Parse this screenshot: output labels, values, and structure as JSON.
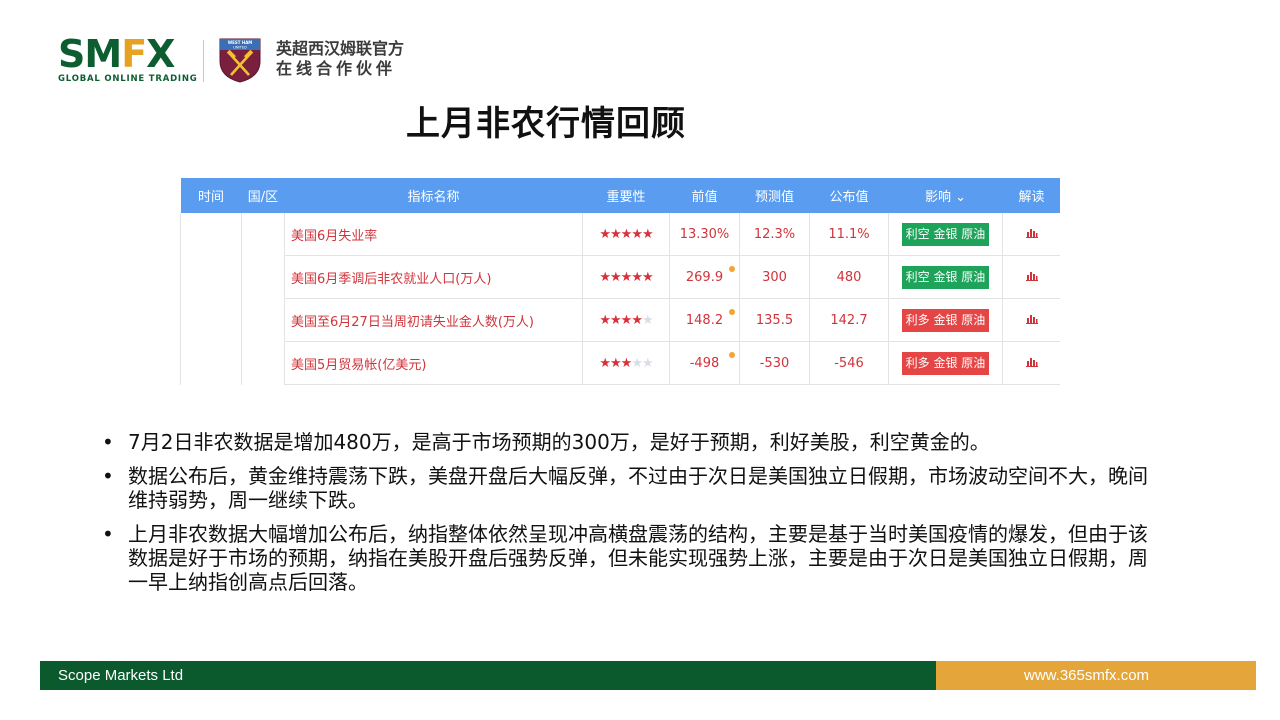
{
  "header": {
    "brand_main": "SMFX",
    "brand_sub": "GLOBAL ONLINE TRADING",
    "crest_text": "WEST HAM UNITED",
    "partner_line1": "英超西汉姆联官方",
    "partner_line2": "在线合作伙伴"
  },
  "title": "上月非农行情回顾",
  "table": {
    "headers": [
      "时间",
      "国/区",
      "指标名称",
      "重要性",
      "前值",
      "预测值",
      "公布值",
      "影响 ⌄",
      "解读"
    ],
    "rows": [
      {
        "name": "美国6月失业率",
        "stars": 5,
        "prev": "13.30%",
        "forecast": "12.3%",
        "actual": "11.1%",
        "impact": "利空 金银 原油",
        "impact_color": "#1da35a",
        "dot": false
      },
      {
        "name": "美国6月季调后非农就业人口(万人)",
        "stars": 5,
        "prev": "269.9",
        "forecast": "300",
        "actual": "480",
        "impact": "利空 金银 原油",
        "impact_color": "#1da35a",
        "dot": true
      },
      {
        "name": "美国至6月27日当周初请失业金人数(万人)",
        "stars": 4,
        "prev": "148.2",
        "forecast": "135.5",
        "actual": "142.7",
        "impact": "利多 金银 原油",
        "impact_color": "#e54545",
        "dot": true
      },
      {
        "name": "美国5月贸易帐(亿美元)",
        "stars": 3,
        "prev": "-498",
        "forecast": "-530",
        "actual": "-546",
        "impact": "利多 金银 原油",
        "impact_color": "#e54545",
        "dot": true
      }
    ]
  },
  "bullets": [
    "7月2日非农数据是增加480万，是高于市场预期的300万，是好于预期，利好美股，利空黄金的。",
    "数据公布后，黄金维持震荡下跌，美盘开盘后大幅反弹，不过由于次日是美国独立日假期，市场波动空间不大，晚间维持弱势，周一继续下跌。",
    "上月非农数据大幅增加公布后，纳指整体依然呈现冲高横盘震荡的结构，主要是基于当时美国疫情的爆发，但由于该数据是好于市场的预期，纳指在美股开盘后强势反弹，但未能实现强势上涨，主要是由于次日是美国独立日假期，周一早上纳指创高点后回落。"
  ],
  "footer": {
    "company": "Scope Markets Ltd",
    "website": "www.365smfx.com"
  },
  "colors": {
    "brand_green": "#0c5e30",
    "brand_gold": "#e6a321",
    "table_header": "#5a9df0",
    "positive_badge": "#1da35a",
    "negative_badge": "#e54545"
  }
}
